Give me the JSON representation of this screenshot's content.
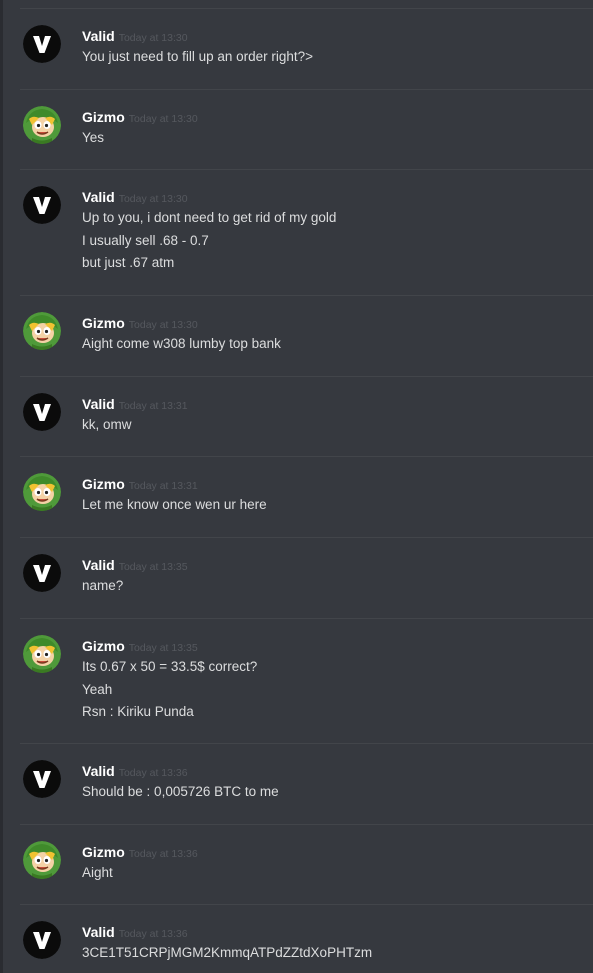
{
  "messages": [
    {
      "author": "Valid",
      "avatar": "valid",
      "time": "Today at 13:30",
      "lines": [
        "You just need to fill up an order right?>"
      ]
    },
    {
      "author": "Gizmo",
      "avatar": "gizmo",
      "time": "Today at 13:30",
      "lines": [
        "Yes"
      ]
    },
    {
      "author": "Valid",
      "avatar": "valid",
      "time": "Today at 13:30",
      "lines": [
        "Up to you, i dont need to get rid of my gold",
        "I usually sell .68 - 0.7",
        "but just .67 atm"
      ]
    },
    {
      "author": "Gizmo",
      "avatar": "gizmo",
      "time": "Today at 13:30",
      "lines": [
        "Aight come w308 lumby top bank"
      ]
    },
    {
      "author": "Valid",
      "avatar": "valid",
      "time": "Today at 13:31",
      "lines": [
        "kk, omw"
      ]
    },
    {
      "author": "Gizmo",
      "avatar": "gizmo",
      "time": "Today at 13:31",
      "lines": [
        "Let me know once wen ur here"
      ]
    },
    {
      "author": "Valid",
      "avatar": "valid",
      "time": "Today at 13:35",
      "lines": [
        "name?"
      ]
    },
    {
      "author": "Gizmo",
      "avatar": "gizmo",
      "time": "Today at 13:35",
      "lines": [
        "Its 0.67 x 50 = 33.5$ correct?",
        "Yeah",
        "Rsn : Kiriku Punda"
      ]
    },
    {
      "author": "Valid",
      "avatar": "valid",
      "time": "Today at 13:36",
      "lines": [
        "Should be : 0,005726 BTC to me"
      ]
    },
    {
      "author": "Gizmo",
      "avatar": "gizmo",
      "time": "Today at 13:36",
      "lines": [
        "Aight"
      ]
    },
    {
      "author": "Valid",
      "avatar": "valid",
      "time": "Today at 13:36",
      "lines": [
        "3CE1T51CRPjMGM2KmmqATPdZZtdXoPHTzm"
      ]
    }
  ],
  "avatar_icons": {
    "valid": "v-logo-icon",
    "gizmo": "cartoon-elf-icon"
  },
  "colors": {
    "background": "#36393f",
    "author": "#ffffff",
    "text": "#dcddde",
    "timestamp": "#55585e",
    "separator": "#42454a"
  }
}
